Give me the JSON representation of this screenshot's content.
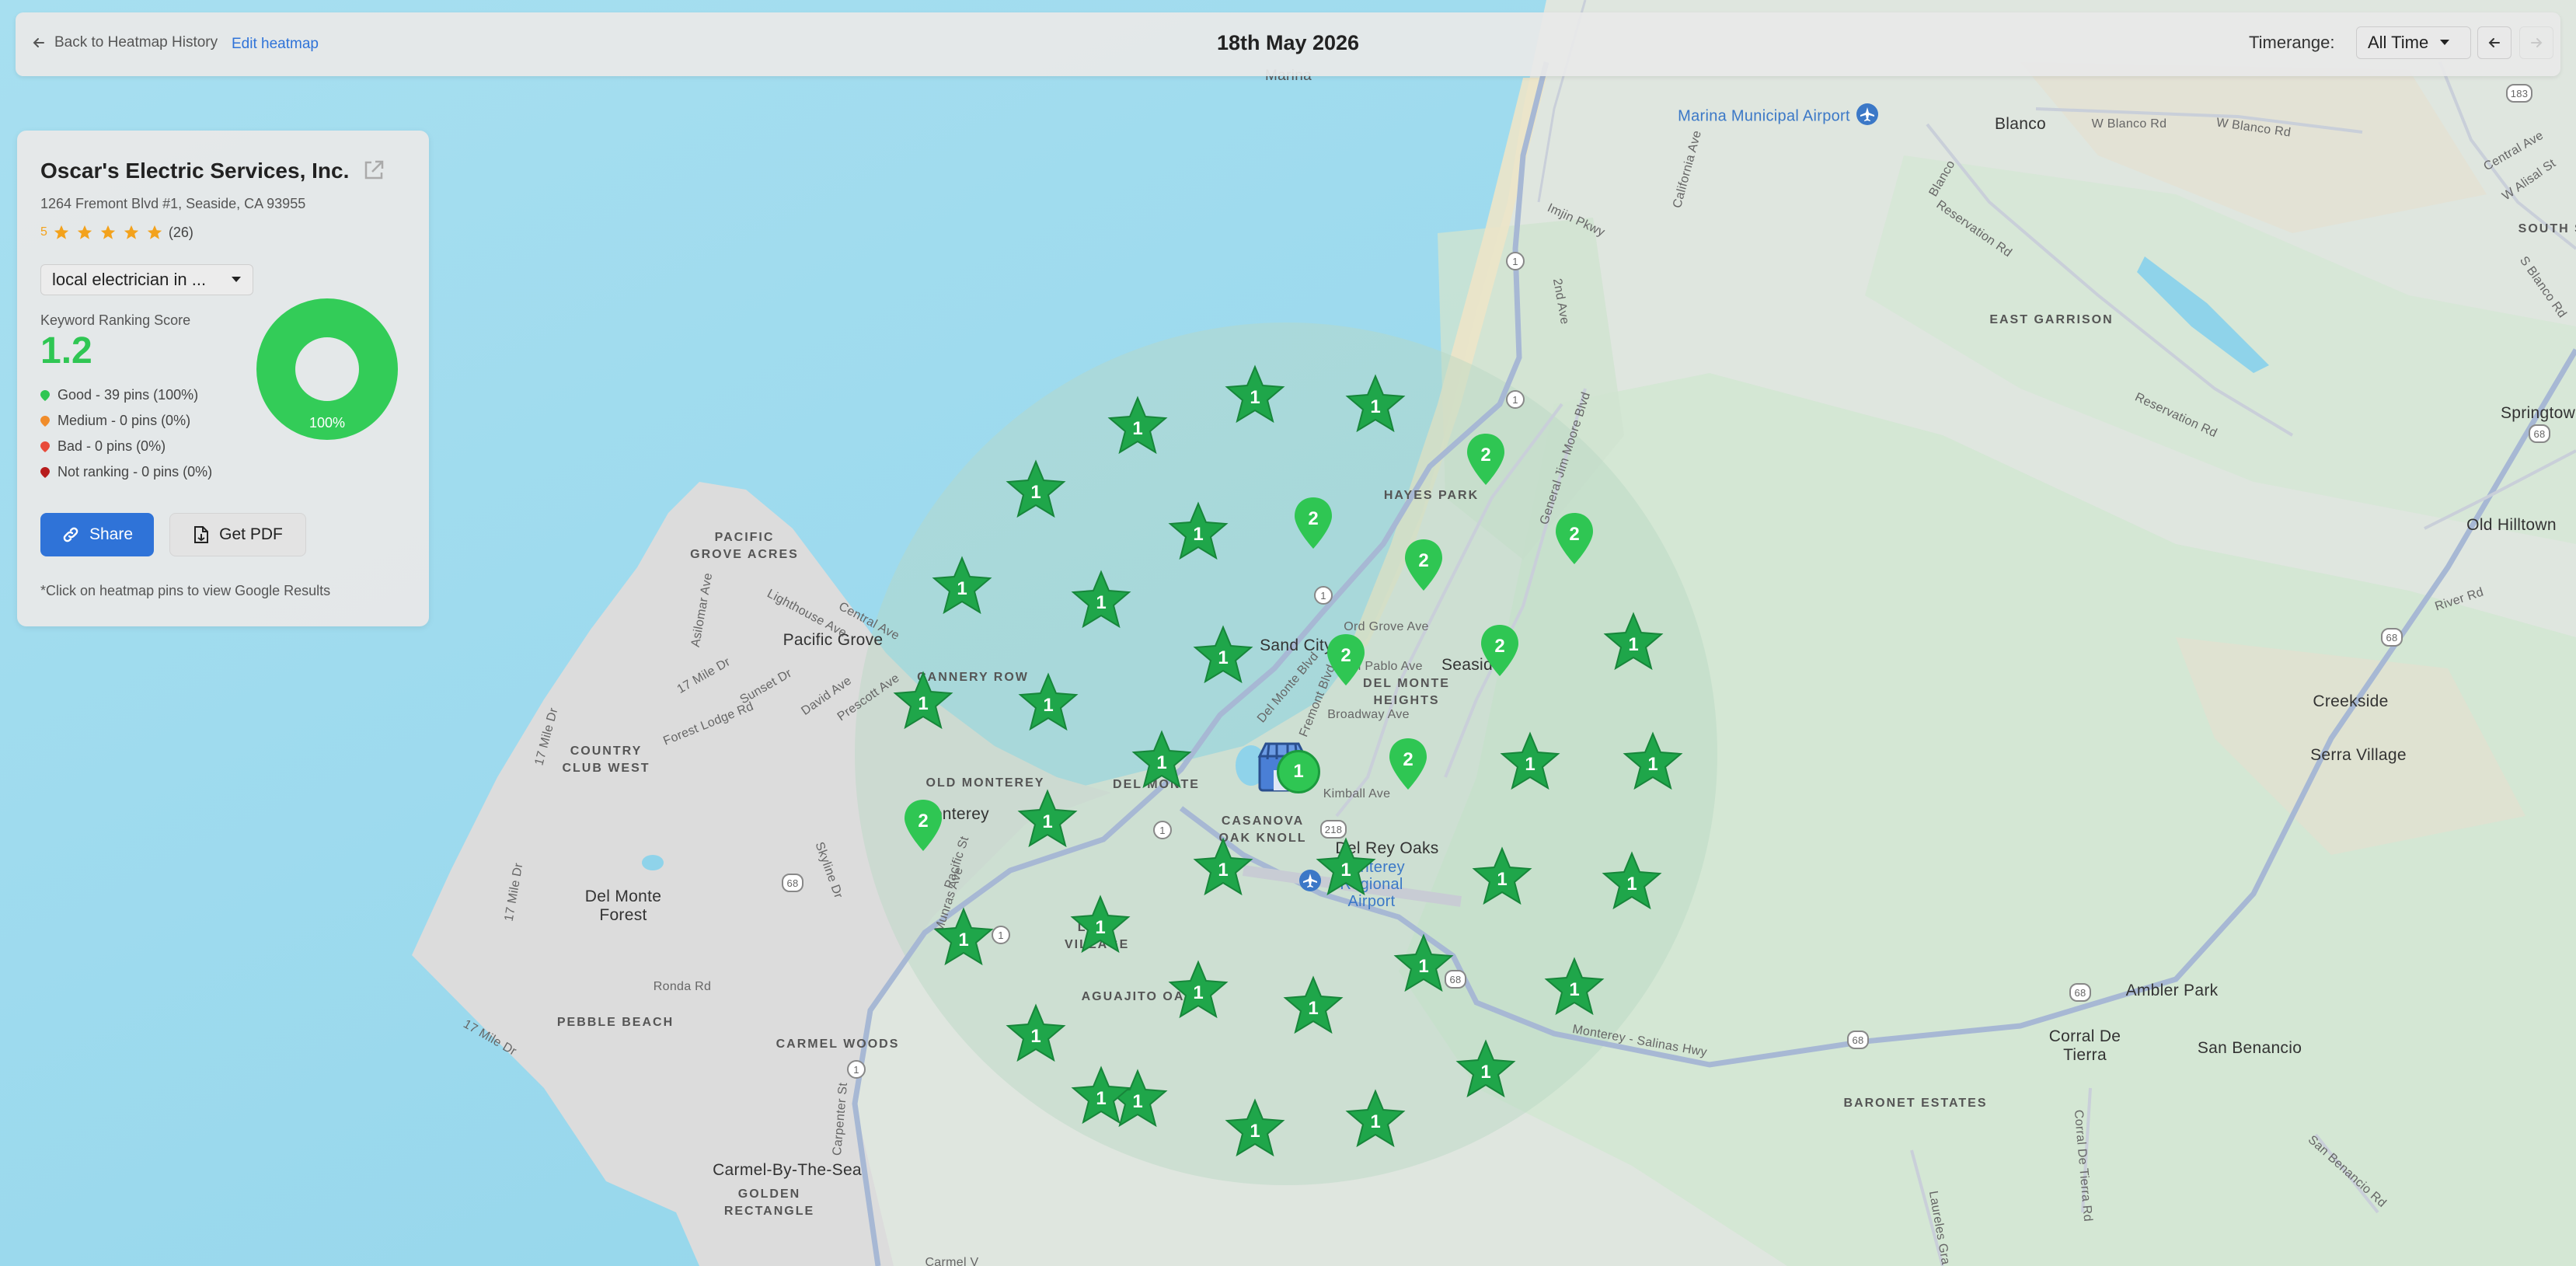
{
  "colors": {
    "accent": "#2f73d8",
    "good": "#2fc653",
    "medium": "#f08c2a",
    "bad": "#e84a3a",
    "not_ranking": "#b71c1c",
    "star": "#1fa64a",
    "rating_star": "#f3a21c"
  },
  "topbar": {
    "back_label": "Back to Heatmap History",
    "edit_label": "Edit heatmap",
    "date": "18th May 2026",
    "timerange_label": "Timerange:",
    "timerange_value": "All Time"
  },
  "panel": {
    "business_name": "Oscar's Electric Services, Inc.",
    "address": "1264 Fremont Blvd #1, Seaside, CA 93955",
    "rating_value": "5",
    "rating_count": "(26)",
    "keyword": "local electrician in ...",
    "score_label": "Keyword Ranking Score",
    "score": "1.2",
    "legend": [
      {
        "label": "Good",
        "value": "39 pins (100%)"
      },
      {
        "label": "Medium",
        "value": "0 pins (0%)"
      },
      {
        "label": "Bad",
        "value": "0 pins (0%)"
      },
      {
        "label": "Not ranking",
        "value": "0 pins (0%)"
      }
    ],
    "donut_percent": "100%",
    "share_label": "Share",
    "pdf_label": "Get PDF",
    "hint": "*Click on heatmap pins to view Google Results"
  },
  "map": {
    "labels": {
      "marina": "Marina",
      "marina_airport": "Marina Municipal Airport",
      "blanco": "Blanco",
      "w_blanco_rd": "W Blanco Rd",
      "w_blanco_rd2": "W Blanco Rd",
      "reservation_rd": "Reservation Rd",
      "east_garrison": "EAST GARRISON",
      "springtown": "Springtown",
      "old_hilltown": "Old Hilltown",
      "river_rd": "River Rd",
      "creekside": "Creekside",
      "serra_village": "Serra Village",
      "ambler_park": "Ambler Park",
      "corral_de_tierra": "Corral De Tierra",
      "san_benancio": "San Benancio",
      "baronet_estates": "BARONET ESTATES",
      "hayes_park": "HAYES PARK",
      "sand_city": "Sand City",
      "seaside": "Seasid",
      "ord_grove": "Ord Grove Ave",
      "del_monte_heights": "DEL MONTE HEIGHTS",
      "broadway": "Broadway Ave",
      "kimball": "Kimball Ave",
      "del_rey_oaks": "Del Rey Oaks",
      "casanova": "CASANOVA OAK KNOLL",
      "monterey_airport": "Monterey Regional Airport",
      "old_monterey": "OLD MONTEREY",
      "del_monte": "DEL MONTE",
      "monterey": "Monterey",
      "pacific_grove": "Pacific Grove",
      "pacific_grove_acres": "PACIFIC GROVE ACRES",
      "cannery_row": "CANNERY ROW",
      "country_club": "COUNTRY CLUB WEST",
      "del_monte_forest": "Del Monte Forest",
      "pebble_beach": "PEBBLE BEACH",
      "carmel_woods": "CARMEL WOODS",
      "carmel": "Carmel-By-The-Sea",
      "golden_rect": "GOLDEN RECTANGLE",
      "aguajito": "AGUAJITO OA",
      "la_mesa": "LA M VILLAGE",
      "monterey_salinas_hwy": "Monterey - Salinas Hwy",
      "general_jim_moore": "General Jim Moore Blvd",
      "second_ave": "2nd Ave",
      "fremont": "Fremont Blvd",
      "del_monte_blvd": "Del Monte Blvd",
      "lighthouse": "Lighthouse Ave",
      "forest_lodge": "Forest Lodge Rd",
      "ronda": "Ronda Rd",
      "seventeen_mile": "17 Mile Dr",
      "prescott": "Prescott Ave",
      "david": "David Ave",
      "central": "Central Ave",
      "sunset": "Sunset Dr",
      "asilomar": "Asilomar Ave",
      "skyline": "Skyline Dr",
      "pacific_st": "Pacific St",
      "munras": "Munras Ave",
      "carpenter": "Carpenter St",
      "imjin": "Imjin Pkwy",
      "california": "California Ave",
      "la_pablo": "an Pablo Ave",
      "south_sa": "SOUTH SA",
      "w_alisal": "W Alisal St",
      "central_ave_e": "Central Ave",
      "s_blanco": "S Blanco Rd",
      "corral_rd": "Corral De Tierra Rd",
      "san_benancio_rd": "San Benancio Rd",
      "laureles": "Laureles Gra",
      "carmel_v": "Carmel V",
      "s17mile": "17 Mile Dr",
      "shield_1a": "1",
      "shield_1b": "1",
      "shield_1c": "1",
      "shield_1d": "1",
      "shield_1e": "1",
      "shield_218": "218",
      "shield_68a": "68",
      "shield_68b": "68",
      "shield_68c": "68",
      "shield_68d": "68",
      "shield_68e": "68",
      "shield_68f": "68",
      "shield_183": "183"
    },
    "pins": [
      {
        "type": "star",
        "value": "1"
      },
      {
        "type": "star",
        "value": "1"
      },
      {
        "type": "star",
        "value": "1"
      },
      {
        "type": "star",
        "value": "1"
      },
      {
        "type": "star",
        "value": "1"
      },
      {
        "type": "drop",
        "value": "2"
      },
      {
        "type": "drop",
        "value": "2"
      },
      {
        "type": "drop",
        "value": "2"
      },
      {
        "type": "star",
        "value": "1"
      },
      {
        "type": "star",
        "value": "1"
      },
      {
        "type": "star",
        "value": "1"
      },
      {
        "type": "drop",
        "value": "2"
      },
      {
        "type": "drop",
        "value": "2"
      },
      {
        "type": "drop",
        "value": "2"
      },
      {
        "type": "star",
        "value": "1"
      },
      {
        "type": "star",
        "value": "1"
      },
      {
        "type": "star",
        "value": "1"
      },
      {
        "type": "star",
        "value": "1"
      },
      {
        "type": "star",
        "value": "1"
      },
      {
        "type": "drop",
        "value": "2"
      },
      {
        "type": "star",
        "value": "1"
      },
      {
        "type": "star",
        "value": "1"
      },
      {
        "type": "drop",
        "value": "2"
      },
      {
        "type": "star",
        "value": "1"
      },
      {
        "type": "star",
        "value": "1"
      },
      {
        "type": "star",
        "value": "1"
      },
      {
        "type": "star",
        "value": "1"
      },
      {
        "type": "star",
        "value": "1"
      },
      {
        "type": "star",
        "value": "1"
      },
      {
        "type": "star",
        "value": "1"
      },
      {
        "type": "star",
        "value": "1"
      },
      {
        "type": "star",
        "value": "1"
      },
      {
        "type": "star",
        "value": "1"
      },
      {
        "type": "star",
        "value": "1"
      },
      {
        "type": "star",
        "value": "1"
      },
      {
        "type": "star",
        "value": "1"
      },
      {
        "type": "star",
        "value": "1"
      },
      {
        "type": "star",
        "value": "1"
      },
      {
        "type": "star",
        "value": "1"
      }
    ],
    "business_marker_rank": "1"
  }
}
